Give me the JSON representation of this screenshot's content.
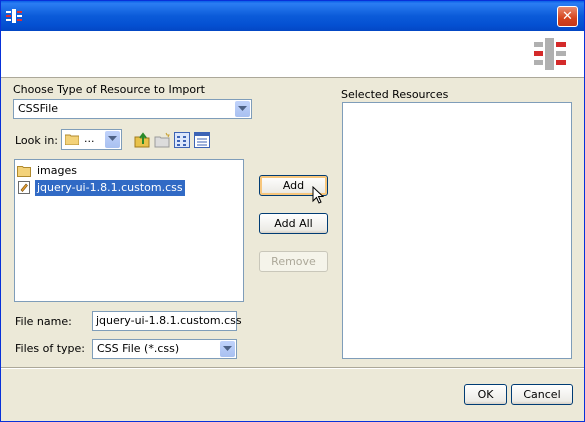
{
  "window": {
    "close_glyph": "✕"
  },
  "import_panel": {
    "choose_type_label": "Choose Type of Resource to Import",
    "resource_type_value": "CSSFile",
    "look_in_label": "Look in:",
    "look_in_value": "...",
    "file_list": [
      {
        "name": "images",
        "icon": "folder-icon",
        "selected": false
      },
      {
        "name": "jquery-ui-1.8.1.custom.css",
        "icon": "css-file-icon",
        "selected": true
      }
    ],
    "file_name_label": "File name:",
    "file_name_value": "jquery-ui-1.8.1.custom.css",
    "files_of_type_label": "Files of type:",
    "files_of_type_value": "CSS File (*.css)"
  },
  "actions": {
    "add_label": "Add",
    "add_all_label": "Add All",
    "remove_label": "Remove"
  },
  "selected_panel": {
    "title": "Selected Resources",
    "items": []
  },
  "footer": {
    "ok_label": "OK",
    "cancel_label": "Cancel"
  },
  "colors": {
    "titlebar": "#0a5fe8",
    "selection": "#316ac5",
    "dialog_bg": "#ece9d8"
  }
}
